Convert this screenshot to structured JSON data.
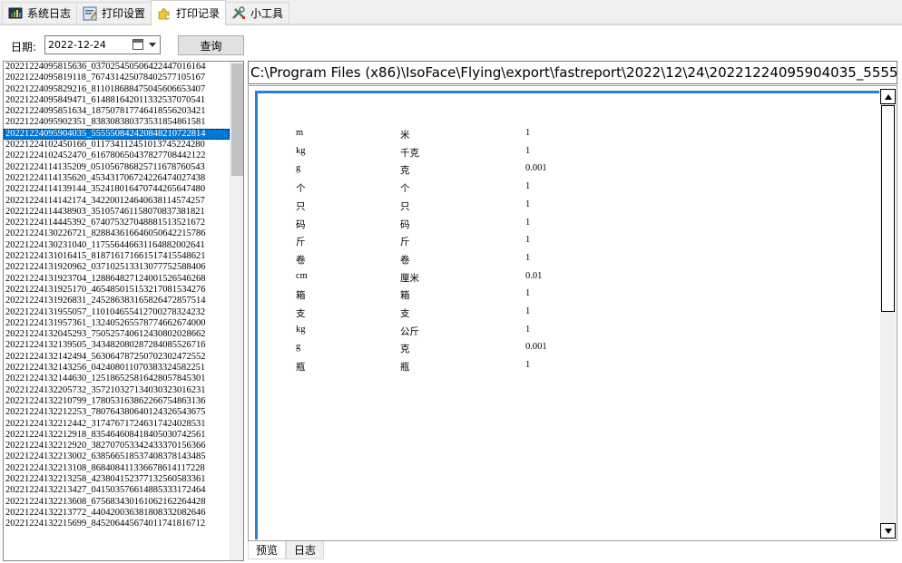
{
  "tabs": [
    {
      "label": "系统日志",
      "icon": "chart-monitor-icon"
    },
    {
      "label": "打印设置",
      "icon": "settings-edit-icon"
    },
    {
      "label": "打印记录",
      "icon": "puzzle-icon"
    },
    {
      "label": "小工具",
      "icon": "tools-icon"
    }
  ],
  "active_tab": "打印记录",
  "filter": {
    "date_label": "日期:",
    "date_value": "2022-12-24",
    "query_button": "查询"
  },
  "files": [
    "20221224095815636_037025450506422447016164",
    "20221224095819118_767431425078402577105167",
    "20221224095829216_811018688475045606653407",
    "20221224095849471_614881642011332537070541",
    "20221224095851634_187507817746418556203421",
    "20221224095902351_838308380373531854861581",
    "20221224095904035_555550842420848210722814",
    "20221224102450166_011734112451013745224280",
    "20221224102452470_616780650437827708442122",
    "20221224114135209_051056786825711678760543",
    "20221224114135620_453431706724226474027438",
    "20221224114139144_352418016470744265647480",
    "20221224114142174_342200124640638114574257",
    "20221224114438903_351057461158070837381821",
    "20221224114445392_674075327048881513521672",
    "20221224130226721_828843616646050642215786",
    "20221224130231040_117556446631164882002641",
    "20221224131016415_818716171661517415548621",
    "20221224131920962_037102513313077752588406",
    "20221224131923704_128864827124001526546268",
    "20221224131925170_465485015153217081534276",
    "20221224131926831_245286383165826472857514",
    "20221224131955057_110104655412700278324232",
    "20221224131957361_132405265578774662674000",
    "20221224132045293_750525740612430802028662",
    "20221224132139505_343482080287284085526716",
    "20221224132142494_563064787250702302472552",
    "20221224132143256_042408011070383324582251",
    "20221224132144630_125186525816428057845301",
    "20221224132205732_357210327134030323016231",
    "20221224132210799_178053163862266754863136",
    "20221224132212253_780764380640124326543675",
    "20221224132212442_317476717246317424028531",
    "20221224132212918_835464608418405030742561",
    "20221224132212920_382707053342433370156366",
    "20221224132213002_638566518537408378143485",
    "20221224132213108_868408411336678614117228",
    "20221224132213258_423804152377132560583361",
    "20221224132213427_041503576614885333172464",
    "20221224132213608_675683430161062162264428",
    "20221224132213772_440420036381808332082646",
    "20221224132215699_845206445674011741816712"
  ],
  "selected_file_index": 6,
  "path": "C:\\Program Files (x86)\\IsoFace\\Flying\\export\\fastreport\\2022\\12\\24\\20221224095904035_555550842420848210722814",
  "preview_rows": [
    {
      "code": "m",
      "name": "米",
      "ratio": "1"
    },
    {
      "code": "kg",
      "name": "千克",
      "ratio": "1"
    },
    {
      "code": "g",
      "name": "克",
      "ratio": "0.001"
    },
    {
      "code": "个",
      "name": "个",
      "ratio": "1"
    },
    {
      "code": "只",
      "name": "只",
      "ratio": "1"
    },
    {
      "code": "码",
      "name": "码",
      "ratio": "1"
    },
    {
      "code": "斤",
      "name": "斤",
      "ratio": "1"
    },
    {
      "code": "卷",
      "name": "卷",
      "ratio": "1"
    },
    {
      "code": "cm",
      "name": "厘米",
      "ratio": "0.01"
    },
    {
      "code": "箱",
      "name": "箱",
      "ratio": "1"
    },
    {
      "code": "支",
      "name": "支",
      "ratio": "1"
    },
    {
      "code": "kg",
      "name": "公斤",
      "ratio": "1"
    },
    {
      "code": "g",
      "name": "克",
      "ratio": "0.001"
    },
    {
      "code": "瓶",
      "name": "瓶",
      "ratio": "1"
    }
  ],
  "bottom_tabs": [
    "预览",
    "日志"
  ],
  "active_bottom_tab": "预览",
  "colors": {
    "selection": "#0078d7",
    "doc_border": "#2b7fd4"
  }
}
